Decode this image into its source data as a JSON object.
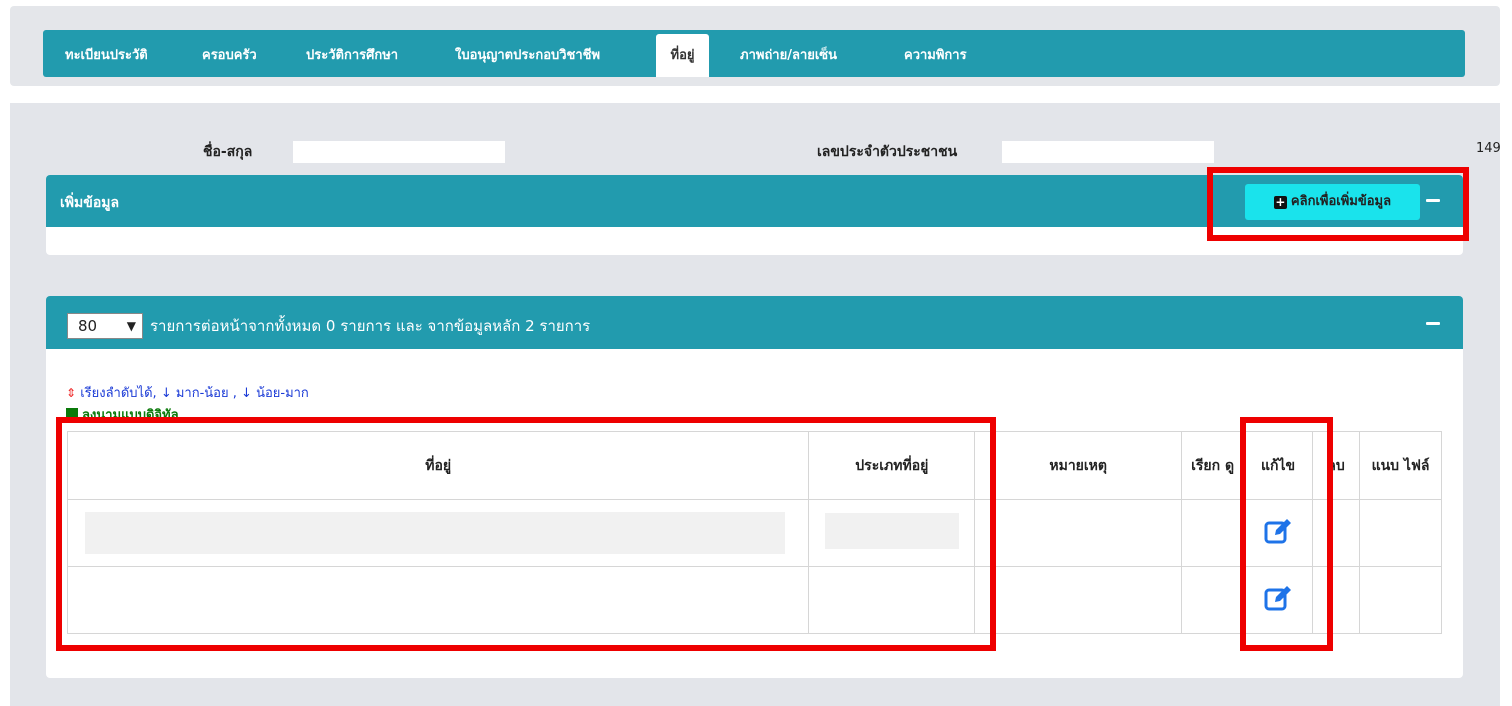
{
  "tabs": [
    {
      "label": "ทะเบียนประวัติ"
    },
    {
      "label": "ครอบครัว"
    },
    {
      "label": "ประวัติการศึกษา"
    },
    {
      "label": "ใบอนุญาตประกอบวิชาชีพ"
    },
    {
      "label": "ที่อยู่"
    },
    {
      "label": "ภาพถ่าย/ลายเซ็น"
    },
    {
      "label": "ความพิการ"
    }
  ],
  "person": {
    "name_label": "ชื่อ-สกุล",
    "id_label": "เลขประจำตัวประชาชน",
    "page_number": "149"
  },
  "add_panel": {
    "title": "เพิ่มข้อมูล",
    "button_label": "คลิกเพื่อเพิ่มข้อมูล"
  },
  "list_panel": {
    "per_page_value": "80",
    "per_page_text": "รายการต่อหน้าจากทั้งหมด 0 รายการ และ จากข้อมูลหลัก 2 รายการ",
    "sort_hint": "เรียงลำดับได้,",
    "sort_desc": "มาก-น้อย ,",
    "sort_asc": "น้อย-มาก",
    "signature_note": "ลงนามแบบดิจิทัล"
  },
  "table": {
    "headers": {
      "address": "ที่อยู่",
      "address_type": "ประเภทที่อยู่",
      "remark": "หมายเหตุ",
      "view": "เรียก ดู",
      "edit": "แก้ไข",
      "delete": "ลบ",
      "attach": "แนบ ไฟล์"
    }
  },
  "colors": {
    "header_teal": "#229bae",
    "add_button": "#1ae3ec",
    "highlight_red": "#ee0000",
    "edit_icon_blue": "#1e73e8"
  }
}
